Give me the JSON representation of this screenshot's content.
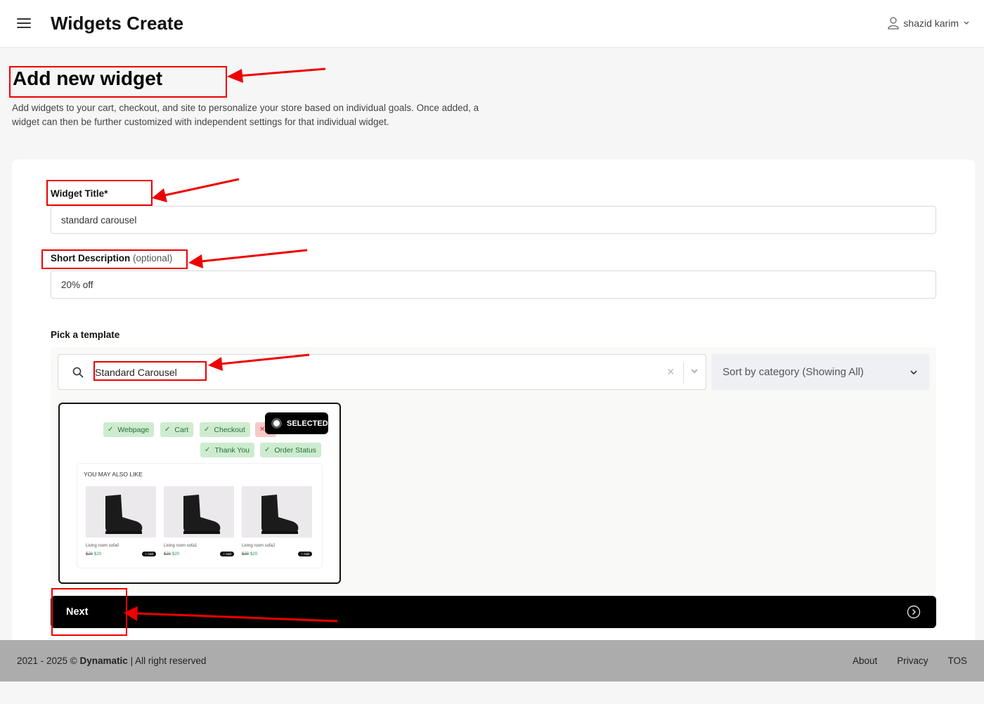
{
  "header": {
    "title": "Widgets Create",
    "user_name": "shazid karim"
  },
  "page": {
    "title": "Add new widget",
    "description": "Add widgets to your cart, checkout, and site to personalize your store based on individual goals. Once added, a widget can then be further customized with independent settings for that individual widget."
  },
  "form": {
    "widget_title_label": "Widget Title*",
    "widget_title_value": "standard carousel",
    "short_desc_label": "Short Description",
    "short_desc_optional": "(optional)",
    "short_desc_value": "20% off",
    "pick_template_label": "Pick a template",
    "search_value": "Standard Carousel",
    "clear_symbol": "×",
    "sort_label": "Sort by category (Showing All)"
  },
  "template_card": {
    "selected_label": "SELECTED",
    "chips": [
      "Webpage",
      "Cart",
      "Checkout",
      "Thank You",
      "Order Status"
    ],
    "preview_heading": "YOU MAY ALSO LIKE",
    "products": [
      {
        "name": "Living room sofa0",
        "old_price": "$20",
        "new_price": "$20",
        "add": "+ Add"
      },
      {
        "name": "Living room sofa1",
        "old_price": "$20",
        "new_price": "$20",
        "add": "+ Add"
      },
      {
        "name": "Living room sofa2",
        "old_price": "$20",
        "new_price": "$20",
        "add": "+ Add"
      }
    ]
  },
  "next_button": {
    "label": "Next"
  },
  "footer": {
    "copyright_prefix": "2021 - 2025 ©",
    "brand": "Dynamatic",
    "copyright_suffix": "| All right reserved",
    "links": [
      "About",
      "Privacy",
      "TOS"
    ]
  },
  "colors": {
    "annotation": "#e00000",
    "chip_bg": "#cdeccf",
    "chip_text": "#2b6b38",
    "footer_bg": "#acacac"
  }
}
